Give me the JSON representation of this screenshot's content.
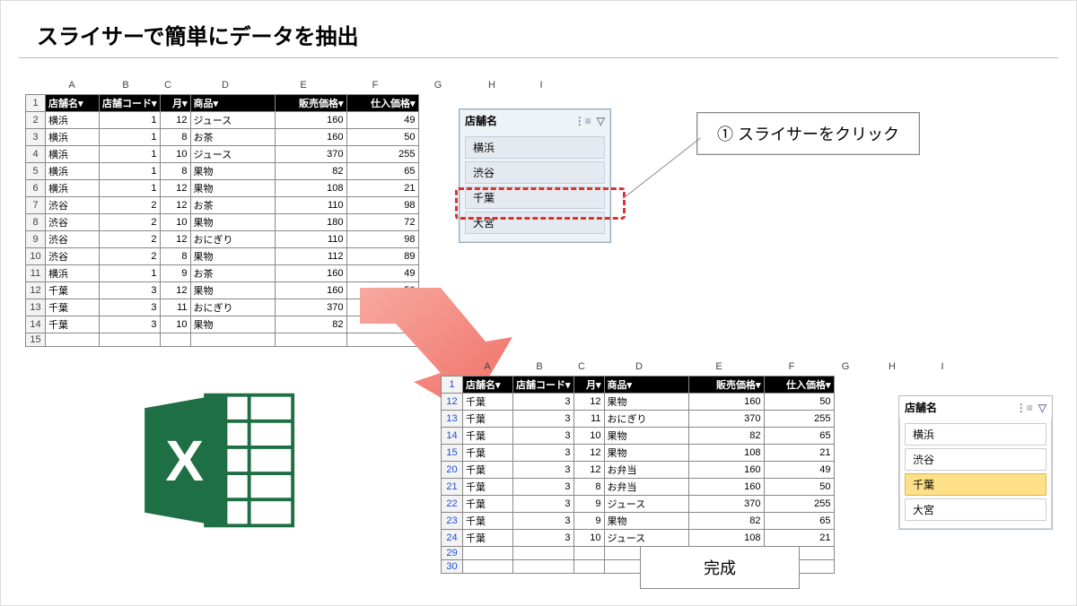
{
  "title": "スライサーで簡単にデータを抽出",
  "callout1": "① スライサーをクリック",
  "doneLabel": "完成",
  "columnsTop": [
    "",
    "A",
    "B",
    "C",
    "D",
    "E",
    "F",
    "G",
    "H",
    "I"
  ],
  "columnsBot": [
    "",
    "A",
    "B",
    "C",
    "D",
    "E",
    "F",
    "G",
    "H",
    "I"
  ],
  "headers": [
    "店舗名",
    "店舗コード",
    "月",
    "商品",
    "販売価格",
    "仕入価格"
  ],
  "tableTop": {
    "rows": [
      {
        "n": 1,
        "hdr": true
      },
      {
        "n": 2,
        "c": [
          "横浜",
          "1",
          "12",
          "ジュース",
          "160",
          "49"
        ]
      },
      {
        "n": 3,
        "c": [
          "横浜",
          "1",
          "8",
          "お茶",
          "160",
          "50"
        ]
      },
      {
        "n": 4,
        "c": [
          "横浜",
          "1",
          "10",
          "ジュース",
          "370",
          "255"
        ]
      },
      {
        "n": 5,
        "c": [
          "横浜",
          "1",
          "8",
          "果物",
          "82",
          "65"
        ]
      },
      {
        "n": 6,
        "c": [
          "横浜",
          "1",
          "12",
          "果物",
          "108",
          "21"
        ]
      },
      {
        "n": 7,
        "c": [
          "渋谷",
          "2",
          "12",
          "お茶",
          "110",
          "98"
        ]
      },
      {
        "n": 8,
        "c": [
          "渋谷",
          "2",
          "10",
          "果物",
          "180",
          "72"
        ]
      },
      {
        "n": 9,
        "c": [
          "渋谷",
          "2",
          "12",
          "おにぎり",
          "110",
          "98"
        ]
      },
      {
        "n": 10,
        "c": [
          "渋谷",
          "2",
          "8",
          "果物",
          "112",
          "89"
        ]
      },
      {
        "n": 11,
        "c": [
          "横浜",
          "1",
          "9",
          "お茶",
          "160",
          "49"
        ]
      },
      {
        "n": 12,
        "c": [
          "千葉",
          "3",
          "12",
          "果物",
          "160",
          "50"
        ]
      },
      {
        "n": 13,
        "c": [
          "千葉",
          "3",
          "11",
          "おにぎり",
          "370",
          "255"
        ]
      },
      {
        "n": 14,
        "c": [
          "千葉",
          "3",
          "10",
          "果物",
          "82",
          "65"
        ]
      }
    ],
    "tail": [
      15
    ]
  },
  "tableBot": {
    "rows": [
      {
        "n": 1,
        "hdr": true
      },
      {
        "n": 12,
        "c": [
          "千葉",
          "3",
          "12",
          "果物",
          "160",
          "50"
        ]
      },
      {
        "n": 13,
        "c": [
          "千葉",
          "3",
          "11",
          "おにぎり",
          "370",
          "255"
        ]
      },
      {
        "n": 14,
        "c": [
          "千葉",
          "3",
          "10",
          "果物",
          "82",
          "65"
        ]
      },
      {
        "n": 15,
        "c": [
          "千葉",
          "3",
          "12",
          "果物",
          "108",
          "21"
        ]
      },
      {
        "n": 20,
        "c": [
          "千葉",
          "3",
          "12",
          "お弁当",
          "160",
          "49"
        ]
      },
      {
        "n": 21,
        "c": [
          "千葉",
          "3",
          "8",
          "お弁当",
          "160",
          "50"
        ]
      },
      {
        "n": 22,
        "c": [
          "千葉",
          "3",
          "9",
          "ジュース",
          "370",
          "255"
        ]
      },
      {
        "n": 23,
        "c": [
          "千葉",
          "3",
          "9",
          "果物",
          "82",
          "65"
        ]
      },
      {
        "n": 24,
        "c": [
          "千葉",
          "3",
          "10",
          "ジュース",
          "108",
          "21"
        ]
      }
    ],
    "tail": [
      29,
      30
    ]
  },
  "slicerTop": {
    "title": "店舗名",
    "items": [
      "横浜",
      "渋谷",
      "千葉",
      "大宮"
    ],
    "highlightIndex": 2
  },
  "slicerBot": {
    "title": "店舗名",
    "items": [
      "横浜",
      "渋谷",
      "千葉",
      "大宮"
    ],
    "selectedIndex": 2
  },
  "colW": {
    "rownum": 22,
    "A": 60,
    "B": 60,
    "C": 34,
    "D": 94,
    "E": 80,
    "F": 80,
    "G": 60,
    "H": 60,
    "I": 50
  },
  "colWBot": {
    "rownum": 24,
    "A": 56,
    "B": 60,
    "C": 34,
    "D": 94,
    "E": 84,
    "F": 78,
    "G": 42,
    "H": 62,
    "I": 50
  }
}
